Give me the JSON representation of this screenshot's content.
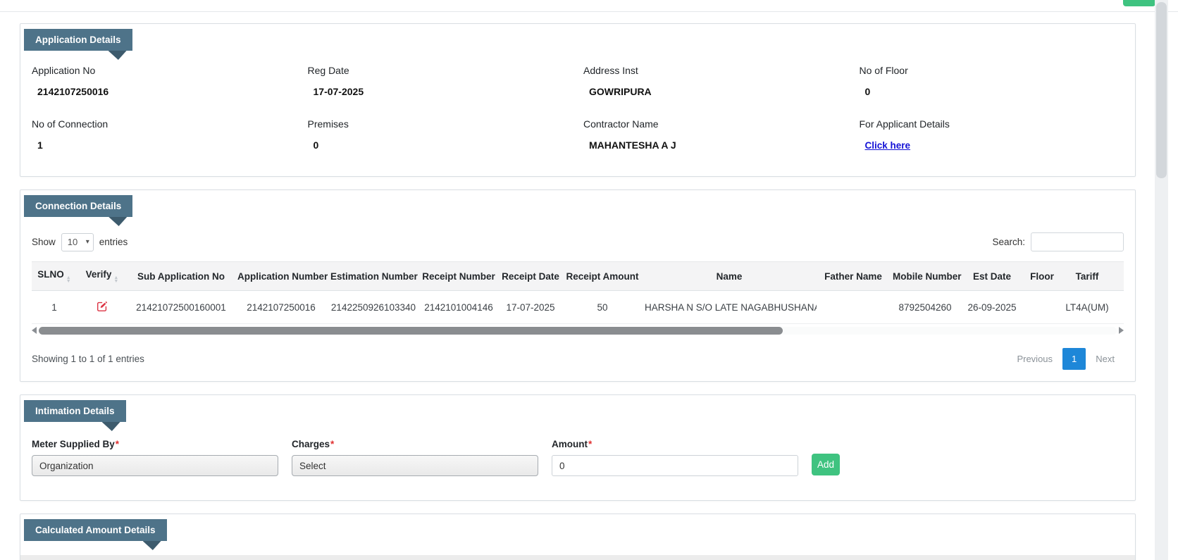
{
  "application_details": {
    "title": "Application Details",
    "fields": [
      {
        "label": "Application No",
        "value": "2142107250016"
      },
      {
        "label": "Reg Date",
        "value": "17-07-2025"
      },
      {
        "label": "Address Inst",
        "value": "GOWRIPURA"
      },
      {
        "label": "No of Floor",
        "value": "0"
      },
      {
        "label": "No of Connection",
        "value": "1"
      },
      {
        "label": "Premises",
        "value": "0"
      },
      {
        "label": "Contractor Name",
        "value": "MAHANTESHA A J"
      },
      {
        "label": "For Applicant Details",
        "value": "Click here"
      }
    ]
  },
  "connection_details": {
    "title": "Connection Details",
    "show_label": "Show",
    "entries_label": "entries",
    "page_length": "10",
    "search_label": "Search:",
    "columns": [
      "SLNO",
      "Verify",
      "Sub Application No",
      "Application Number",
      "Estimation Number",
      "Receipt Number",
      "Receipt Date",
      "Receipt Amount",
      "Name",
      "Father Name",
      "Mobile Number",
      "Est Date",
      "Floor",
      "Tariff",
      ""
    ],
    "row": {
      "slno": "1",
      "sub_application_no": "21421072500160001",
      "application_number": "2142107250016",
      "estimation_number": "2142250926103340",
      "receipt_number": "2142101004146",
      "receipt_date": "17-07-2025",
      "receipt_amount": "50",
      "name": "HARSHA N S/O LATE NAGABHUSHANA G P",
      "father_name": "",
      "mobile_number": "8792504260",
      "est_date": "26-09-2025",
      "floor": "",
      "tariff": "LT4A(UM)",
      "clipped_next": "A"
    },
    "summary": "Showing 1 to 1 of 1 entries",
    "pagination": {
      "previous": "Previous",
      "current": "1",
      "next": "Next"
    }
  },
  "intimation_details": {
    "title": "Intimation Details",
    "required_mark": "*",
    "meter_supplied_by": {
      "label": "Meter Supplied By",
      "value": "Organization"
    },
    "charges": {
      "label": "Charges",
      "value": "Select"
    },
    "amount": {
      "label": "Amount",
      "value": "0"
    },
    "add_button": "Add"
  },
  "calculated_amount_details": {
    "title": "Calculated Amount Details"
  },
  "colors": {
    "ribbon": "#4e7389",
    "ribbon_fold": "#3d5b6d",
    "link": "#1412d6",
    "active_page": "#1e87d8",
    "add_button": "#3fc380",
    "top_button": "#3fc380",
    "verify_icon": "#dc3545",
    "required": "#e03131"
  }
}
